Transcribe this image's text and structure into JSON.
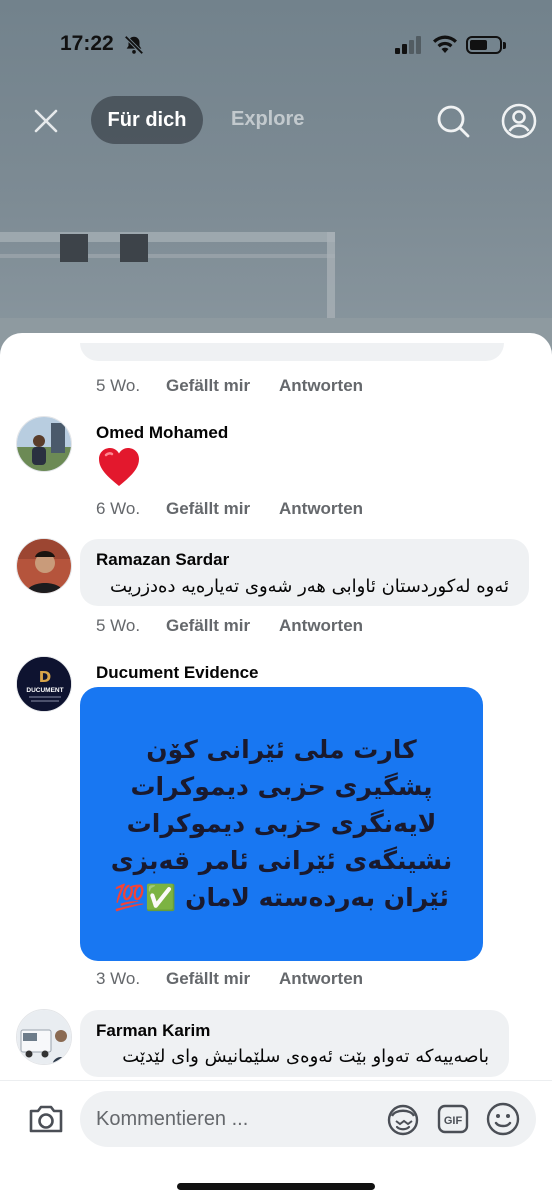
{
  "status_bar": {
    "time": "17:22",
    "icons": [
      "bell-slash-icon",
      "signal-icon",
      "wifi-icon",
      "battery-icon"
    ]
  },
  "top_nav": {
    "tab_active": "Für dich",
    "tab_explore": "Explore",
    "icons": [
      "close-icon",
      "search-icon",
      "profile-icon"
    ]
  },
  "comments": [
    {
      "age": "5 Wo.",
      "like": "Gefällt mir",
      "reply": "Antworten"
    },
    {
      "name": "Omed Mohamed",
      "content": "❤️",
      "age": "6 Wo.",
      "like": "Gefällt mir",
      "reply": "Antworten"
    },
    {
      "name": "Ramazan Sardar",
      "text": "ئەوە  لەکوردستان ئاوابی هەر شەوی تەیارەیە دەدزریت",
      "age": "5 Wo.",
      "like": "Gefällt mir",
      "reply": "Antworten"
    },
    {
      "name": "Ducument Evidence",
      "avatar_label": "DUCUMENT",
      "image_lines": [
        "کارت ملی ئێرانی کۆن",
        "پشگیری حزبی دیموکرات",
        "لایەنگری حزبی دیموکرات",
        "نشینگەی ئێرانی ئامر قەبزی",
        "ئێران بەردەستە لامان ✅💯"
      ],
      "age": "3 Wo.",
      "like": "Gefällt mir",
      "reply": "Antworten"
    },
    {
      "name": "Farman Karim",
      "text": "باصەییەکە تەواو بێت ئەوەی سلێمانیش وای لێدێت"
    }
  ],
  "composer": {
    "placeholder": "Kommentieren ...",
    "icons": [
      "camera-icon",
      "avatar-sticker-icon",
      "gif-icon",
      "emoji-icon"
    ]
  },
  "colors": {
    "accent": "#1877f2",
    "bubble": "#eff1f3",
    "meta_text": "#65686c"
  }
}
